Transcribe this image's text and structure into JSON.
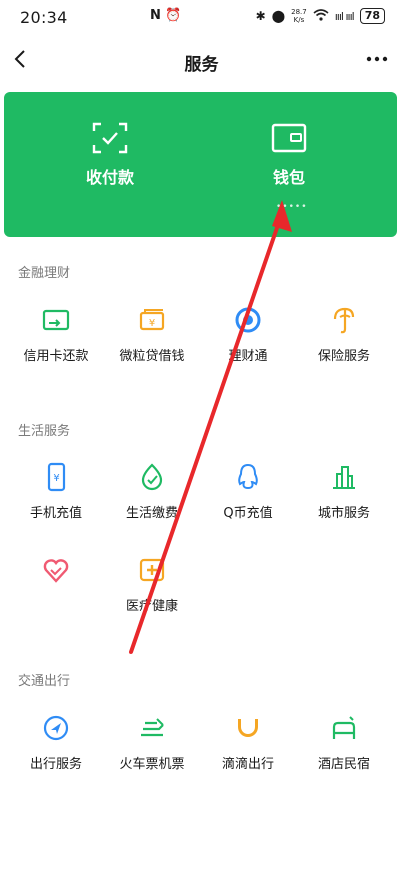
{
  "status": {
    "time": "20:34",
    "mid_icons": "N ⏰",
    "speed_value": "28.7",
    "speed_unit": "K/s",
    "battery": "78",
    "signal": "ıııl ıııl"
  },
  "header": {
    "title": "服务"
  },
  "wallet_card": {
    "items": [
      {
        "label": "收付款",
        "icon": "scan-pay-icon"
      },
      {
        "label": "钱包",
        "icon": "wallet-icon"
      }
    ],
    "dots": "•••••"
  },
  "sections": [
    {
      "title": "金融理财",
      "items": [
        {
          "label": "信用卡还款",
          "icon": "credit-card-icon"
        },
        {
          "label": "微粒贷借钱",
          "icon": "loan-icon"
        },
        {
          "label": "理财通",
          "icon": "wealth-icon"
        },
        {
          "label": "保险服务",
          "icon": "insurance-icon"
        }
      ]
    },
    {
      "title": "生活服务",
      "items": [
        {
          "label": "手机充值",
          "icon": "phone-topup-icon"
        },
        {
          "label": "生活缴费",
          "icon": "utility-payment-icon"
        },
        {
          "label": "Q币充值",
          "icon": "qq-coin-icon"
        },
        {
          "label": "城市服务",
          "icon": "city-service-icon"
        },
        {
          "label": "",
          "icon": "charity-heart-icon"
        },
        {
          "label": "医疗健康",
          "icon": "medical-health-icon"
        }
      ]
    },
    {
      "title": "交通出行",
      "items": [
        {
          "label": "出行服务",
          "icon": "travel-service-icon"
        },
        {
          "label": "火车票机票",
          "icon": "train-plane-ticket-icon"
        },
        {
          "label": "滴滴出行",
          "icon": "didi-ride-icon"
        },
        {
          "label": "酒店民宿",
          "icon": "hotel-icon"
        }
      ]
    }
  ],
  "colors": {
    "brand_green": "#1fba63",
    "arrow_red": "#e8282b",
    "icon_green": "#1fba63",
    "icon_orange": "#f5a623",
    "icon_blue": "#2f8cf5",
    "icon_pink": "#f05a72"
  }
}
